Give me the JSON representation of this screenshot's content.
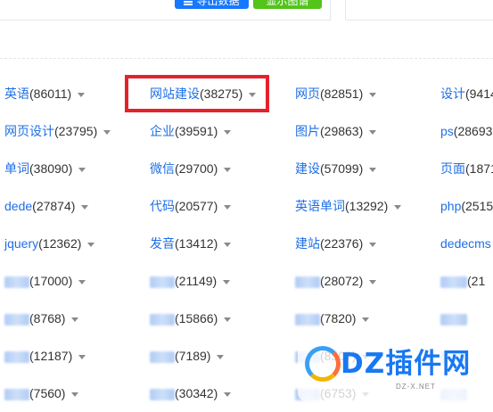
{
  "top": {
    "buttons": [
      {
        "label": "导出数据",
        "color": "#1677ff",
        "icon": "list-icon"
      },
      {
        "label": "显示图谱",
        "color": "#52c41a"
      }
    ]
  },
  "keywords": [
    [
      {
        "name": "英语",
        "count": "(86011)"
      },
      {
        "name": "网站建设",
        "count": "(38275)",
        "highlighted": true
      },
      {
        "name": "网页",
        "count": "(82851)"
      },
      {
        "name": "设计",
        "count": "(9414"
      }
    ],
    [
      {
        "name": "网页设计",
        "count": "(23795)"
      },
      {
        "name": "企业",
        "count": "(39591)"
      },
      {
        "name": "图片",
        "count": "(29863)"
      },
      {
        "name": "ps",
        "count": "(28693"
      }
    ],
    [
      {
        "name": "单词",
        "count": "(38090)"
      },
      {
        "name": "微信",
        "count": "(29700)"
      },
      {
        "name": "建设",
        "count": "(57099)"
      },
      {
        "name": "页面",
        "count": "(1871"
      }
    ],
    [
      {
        "name": "dede",
        "count": "(27874)"
      },
      {
        "name": "代码",
        "count": "(20577)"
      },
      {
        "name": "英语单词",
        "count": "(13292)"
      },
      {
        "name": "php",
        "count": "(2515"
      }
    ],
    [
      {
        "name": "jquery",
        "count": "(12362)"
      },
      {
        "name": "发音",
        "count": "(13412)"
      },
      {
        "name": "建站",
        "count": "(22376)"
      },
      {
        "name": "dedecms",
        "count": ""
      }
    ],
    [
      {
        "name": "",
        "count": "(17000)",
        "blurred": true
      },
      {
        "name": "",
        "count": "(21149)",
        "blurred": true
      },
      {
        "name": "",
        "count": "(28072)",
        "blurred": true
      },
      {
        "name": "",
        "count": "(21",
        "blurred": true
      }
    ],
    [
      {
        "name": "",
        "count": "(8768)",
        "blurred": true
      },
      {
        "name": "",
        "count": "(15866)",
        "blurred": true
      },
      {
        "name": "",
        "count": "(7820)",
        "blurred": true
      },
      {
        "name": "",
        "count": "",
        "blurred": true
      }
    ],
    [
      {
        "name": "",
        "count": "(12187)",
        "blurred": true
      },
      {
        "name": "",
        "count": "(7189)",
        "blurred": true
      },
      {
        "name": "",
        "count": "(8507)",
        "blurred": true
      },
      {
        "name": "",
        "count": "",
        "blurred": true
      }
    ],
    [
      {
        "name": "",
        "count": "(7560)",
        "blurred": true
      },
      {
        "name": "",
        "count": "(30342)",
        "blurred": true
      },
      {
        "name": "",
        "count": "(6753)",
        "blurred": true
      },
      {
        "name": "",
        "count": "",
        "blurred": true
      }
    ]
  ],
  "watermark": {
    "title": "DZ插件网",
    "subtitle": "DZ-X.NET"
  },
  "colors": {
    "link": "#1f6fe5",
    "highlight_border": "#e5222b"
  }
}
